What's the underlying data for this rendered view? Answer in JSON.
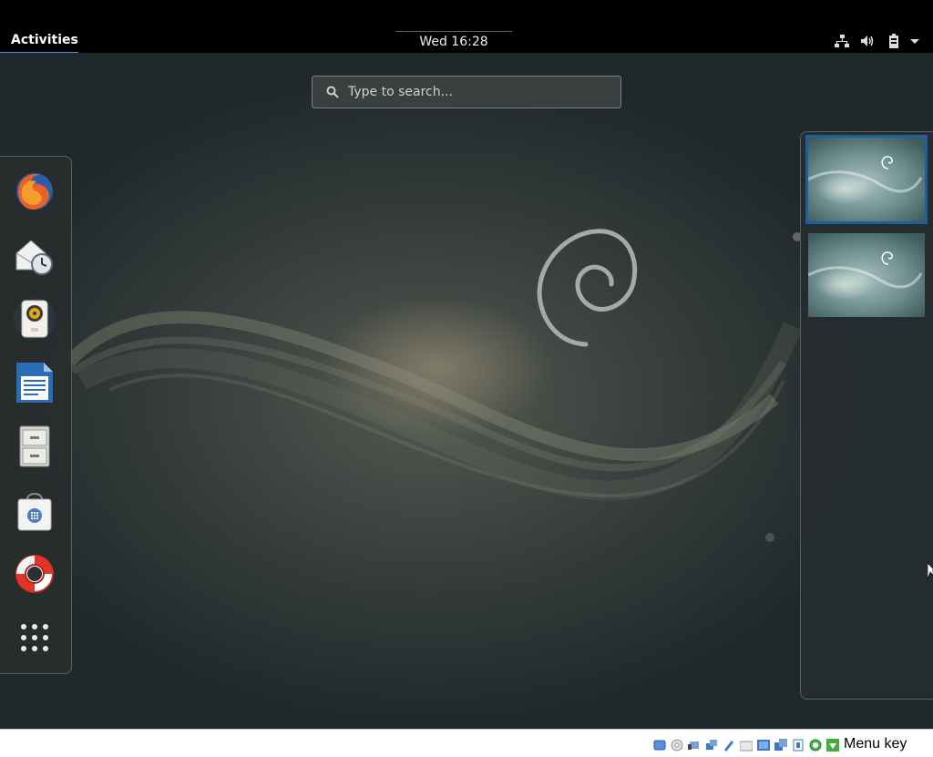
{
  "topbar": {
    "activities_label": "Activities",
    "clock": "Wed 16:28",
    "tray_icons": [
      "network-icon",
      "volume-icon",
      "battery-icon",
      "system-menu-arrow-icon"
    ]
  },
  "search": {
    "placeholder": "Type to search..."
  },
  "dash": {
    "items": [
      {
        "name": "Firefox",
        "icon": "firefox-icon"
      },
      {
        "name": "Evolution",
        "icon": "evolution-mail-icon"
      },
      {
        "name": "Rhythmbox",
        "icon": "rhythmbox-speaker-icon"
      },
      {
        "name": "LibreOffice Writer",
        "icon": "writer-document-icon"
      },
      {
        "name": "Files",
        "icon": "file-cabinet-icon"
      },
      {
        "name": "Software",
        "icon": "software-bag-icon"
      },
      {
        "name": "Help",
        "icon": "lifebuoy-icon"
      },
      {
        "name": "Show Applications",
        "icon": "app-grid-icon"
      }
    ]
  },
  "workspaces": {
    "count": 2,
    "active_index": 0
  },
  "statusbar": {
    "host_key_label": "Menu key",
    "icons": [
      "hdd-icon",
      "optical-icon",
      "audio-icon",
      "network-icon",
      "usb-icon",
      "shared-folder-icon",
      "display-icon",
      "video-capture-icon",
      "cpu-icon",
      "mouse-integration-icon",
      "green-arrow-icon"
    ]
  },
  "colors": {
    "accent": "#4a90d9",
    "active_workspace_border": "#215d9c",
    "topbar": "#000000"
  }
}
